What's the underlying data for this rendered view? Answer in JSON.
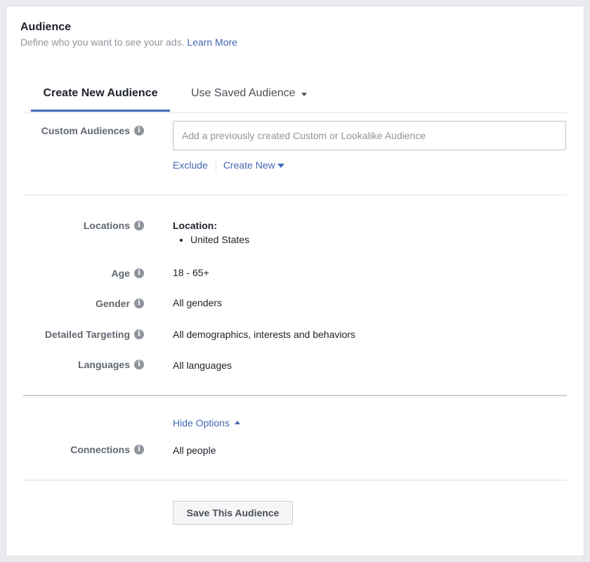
{
  "header": {
    "title": "Audience",
    "subtitle": "Define who you want to see your ads.",
    "learn_more": "Learn More"
  },
  "tabs": {
    "create_new": "Create New Audience",
    "use_saved": "Use Saved Audience"
  },
  "custom_audiences": {
    "label": "Custom Audiences",
    "placeholder": "Add a previously created Custom or Lookalike Audience",
    "exclude": "Exclude",
    "create_new": "Create New"
  },
  "locations": {
    "label": "Locations",
    "heading": "Location:",
    "items": [
      "United States"
    ]
  },
  "age": {
    "label": "Age",
    "value": "18 - 65+"
  },
  "gender": {
    "label": "Gender",
    "value": "All genders"
  },
  "detailed_targeting": {
    "label": "Detailed Targeting",
    "value": "All demographics, interests and behaviors"
  },
  "languages": {
    "label": "Languages",
    "value": "All languages"
  },
  "options": {
    "hide_options": "Hide Options"
  },
  "connections": {
    "label": "Connections",
    "value": "All people"
  },
  "save_button": "Save This Audience",
  "colors": {
    "accent": "#4267b2",
    "label": "#606770",
    "muted": "#90949c"
  },
  "icons": {
    "info": "info-icon",
    "tab_caret": "caret-down-icon",
    "create_caret": "caret-down-icon",
    "hide_caret": "caret-up-icon"
  }
}
